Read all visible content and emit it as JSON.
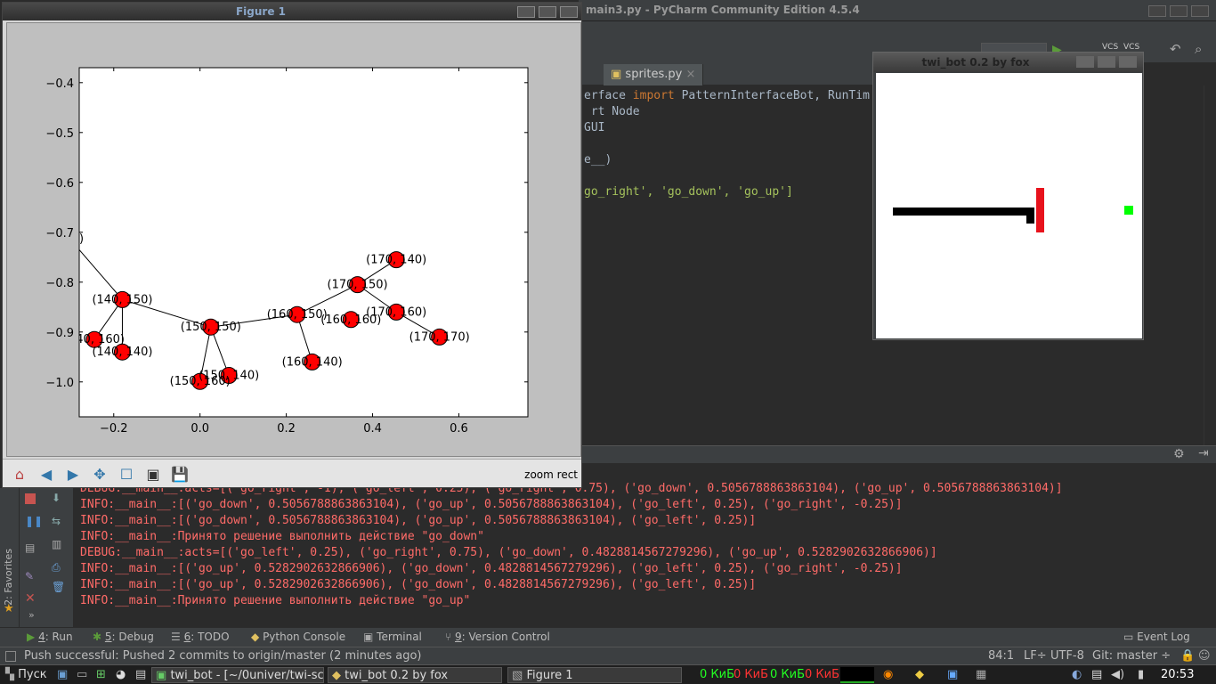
{
  "pycharm": {
    "title": "main3.py - PyCharm Community Edition 4.5.4",
    "tabs": [
      {
        "label": "sprites.py"
      }
    ],
    "code": [
      {
        "pre": "erface ",
        "kw": "import",
        "post": " PatternInterfaceBot, RunTim"
      },
      {
        "pre": "rt Node"
      },
      {
        "pre": "GUI"
      },
      {
        "pre": ""
      },
      {
        "pre": "e__)"
      },
      {
        "pre": ""
      },
      {
        "pre": "go_right', 'go_down', 'go_up']"
      }
    ]
  },
  "figure": {
    "title": "Figure 1",
    "toolbar": {
      "mode": "zoom rect",
      "buttons": [
        "home-icon",
        "back-icon",
        "forward-icon",
        "pan-icon",
        "configure-icon",
        "subplots-icon",
        "save-icon"
      ]
    }
  },
  "chart_data": {
    "type": "scatter",
    "xlim": [
      -0.28,
      0.76
    ],
    "ylim": [
      -1.07,
      -0.37
    ],
    "xticks": [
      "−0.2",
      "0.0",
      "0.2",
      "0.4",
      "0.6"
    ],
    "xtick_values": [
      -0.2,
      0,
      0.2,
      0.4,
      0.6
    ],
    "yticks": [
      "−0.4",
      "−0.5",
      "−0.6",
      "−0.7",
      "−0.8",
      "−0.9",
      "−1.0"
    ],
    "ytick_values": [
      -0.4,
      -0.5,
      -0.6,
      -0.7,
      -0.8,
      -0.9,
      -1.0
    ],
    "nodes": [
      {
        "label": "(140, 150)",
        "x": -0.18,
        "y": -0.835
      },
      {
        "label": "(140, 160)",
        "x": -0.245,
        "y": -0.915
      },
      {
        "label": "(140, 140)",
        "x": -0.18,
        "y": -0.94
      },
      {
        "label": "(150, 150)",
        "x": 0.025,
        "y": -0.89
      },
      {
        "label": "(150, 160)",
        "x": 0,
        "y": -0.999
      },
      {
        "label": "(150, 140)",
        "x": 0.067,
        "y": -0.987
      },
      {
        "label": "(160, 150)",
        "x": 0.225,
        "y": -0.865
      },
      {
        "label": "(160, 140)",
        "x": 0.26,
        "y": -0.96
      },
      {
        "label": "(160, 160)",
        "x": 0.35,
        "y": -0.875
      },
      {
        "label": "(170, 150)",
        "x": 0.365,
        "y": -0.805
      },
      {
        "label": "(170, 140)",
        "x": 0.455,
        "y": -0.755
      },
      {
        "label": "(170, 160)",
        "x": 0.455,
        "y": -0.86
      },
      {
        "label": "(170, 170)",
        "x": 0.555,
        "y": -0.91
      }
    ],
    "edges": [
      [
        0,
        1
      ],
      [
        0,
        2
      ],
      [
        0,
        3
      ],
      [
        3,
        4
      ],
      [
        3,
        5
      ],
      [
        3,
        6
      ],
      [
        6,
        7
      ],
      [
        6,
        9
      ],
      [
        9,
        10
      ],
      [
        9,
        11
      ],
      [
        11,
        12
      ]
    ],
    "offchart_label": ")"
  },
  "bot": {
    "title": "twi_bot 0.2 by fox"
  },
  "run": {
    "logs": [
      "DEBUG:__main__:acts=[('go_right', -1), ('go_left', 0.25), ('go_right', 0.75), ('go_down', 0.5056788863863104), ('go_up', 0.5056788863863104)]",
      "INFO:__main__:[('go_down', 0.5056788863863104), ('go_up', 0.5056788863863104), ('go_left', 0.25), ('go_right', -0.25)]",
      "INFO:__main__:[('go_down', 0.5056788863863104), ('go_up', 0.5056788863863104), ('go_left', 0.25)]",
      "INFO:__main__:Принято решение выполнить действие \"go_down\"",
      "DEBUG:__main__:acts=[('go_left', 0.25), ('go_right', 0.75), ('go_down', 0.4828814567279296), ('go_up', 0.5282902632866906)]",
      "INFO:__main__:[('go_up', 0.5282902632866906), ('go_down', 0.4828814567279296), ('go_left', 0.25), ('go_right', -0.25)]",
      "INFO:__main__:[('go_up', 0.5282902632866906), ('go_down', 0.4828814567279296), ('go_left', 0.25)]",
      "INFO:__main__:Принято решение выполнить действие \"go_up\""
    ]
  },
  "toolwindows": [
    {
      "num": "4",
      "label": ": Run"
    },
    {
      "num": "5",
      "label": ": Debug"
    },
    {
      "num": "6",
      "label": ": TODO"
    },
    {
      "num": "",
      "label": "Python Console"
    },
    {
      "num": "",
      "label": "Terminal"
    },
    {
      "num": "9",
      "label": ": Version Control"
    }
  ],
  "event_log": "Event Log",
  "favorites": "2: Favorites",
  "status": {
    "message": "Push successful: Pushed 2 commits to origin/master (2 minutes ago)",
    "position": "84:1",
    "line_sep": "LF÷",
    "encoding": "UTF-8",
    "git": "Git: master ÷"
  },
  "taskbar": {
    "start": "Пуск",
    "windows": [
      "twi_bot - [~/0univer/twi-sci/...",
      "twi_bot 0.2 by fox",
      "Figure 1"
    ],
    "net": [
      "0 КиБ",
      "0 КиБ",
      "0 КиБ",
      "0 КиБ"
    ],
    "clock": "20:53"
  }
}
